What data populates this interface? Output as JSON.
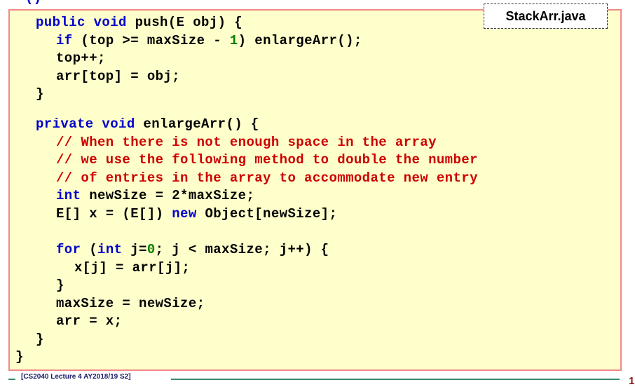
{
  "slide": {
    "clipped_header": "   ()",
    "filename": "StackArr.java",
    "footer": "[CS2040 Lecture 4 AY2018/19 S2]",
    "page_number": "1"
  },
  "code": {
    "l1": {
      "kw1": "public void",
      "rest": " push(E obj) {"
    },
    "l2": {
      "kw1": "if",
      "a": " (top >= maxSize - ",
      "num": "1",
      "b": ") enlargeArr();"
    },
    "l3": {
      "text": "top++;"
    },
    "l4": {
      "text": "arr[top] = obj;"
    },
    "l5": {
      "text": "}"
    },
    "l6": {
      "kw1": "private void",
      "rest": " enlargeArr() {"
    },
    "l7": {
      "cmt": "// When there is not enough space in the array"
    },
    "l8": {
      "cmt": "// we use the following method to double the number"
    },
    "l9": {
      "cmt": "// of entries in the array to accommodate new entry"
    },
    "l10": {
      "kw1": "int",
      "rest": " newSize = 2*maxSize;"
    },
    "l11": {
      "a": "E[] x = (E[]) ",
      "kw1": "new",
      "b": " Object[newSize];"
    },
    "l12": {
      "kw1": "for",
      "a": " (",
      "kw2": "int",
      "b": " j=",
      "num": "0",
      "c": "; j < maxSize; j++) {"
    },
    "l13": {
      "text": "x[j] = arr[j];"
    },
    "l14": {
      "text": "}"
    },
    "l15": {
      "text": "maxSize = newSize;"
    },
    "l16": {
      "text": "arr = x;"
    },
    "l17": {
      "text": "}"
    },
    "l18": {
      "text": "}"
    }
  }
}
